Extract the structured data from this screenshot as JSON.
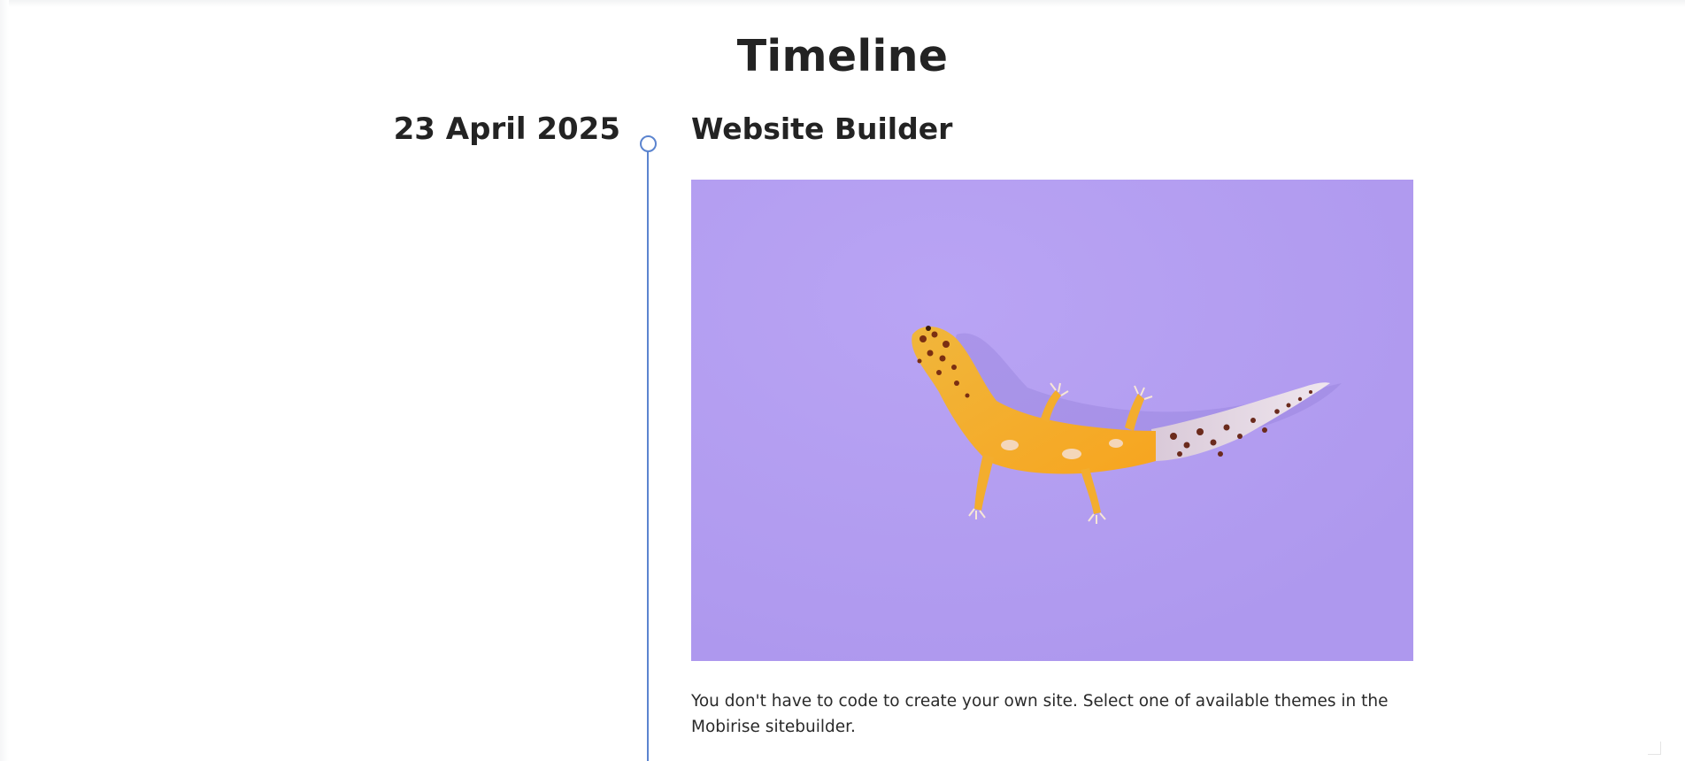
{
  "page": {
    "title": "Timeline"
  },
  "timeline": {
    "items": [
      {
        "date": "23 April 2025",
        "title": "Website Builder",
        "image_subject": "gecko-photo",
        "text": "You don't have to code to create your own site. Select one of available themes in the Mobirise sitebuilder."
      }
    ]
  },
  "colors": {
    "accent_line": "#5b84cf",
    "image_background": "#b49ef0",
    "heading_text": "#232323"
  }
}
